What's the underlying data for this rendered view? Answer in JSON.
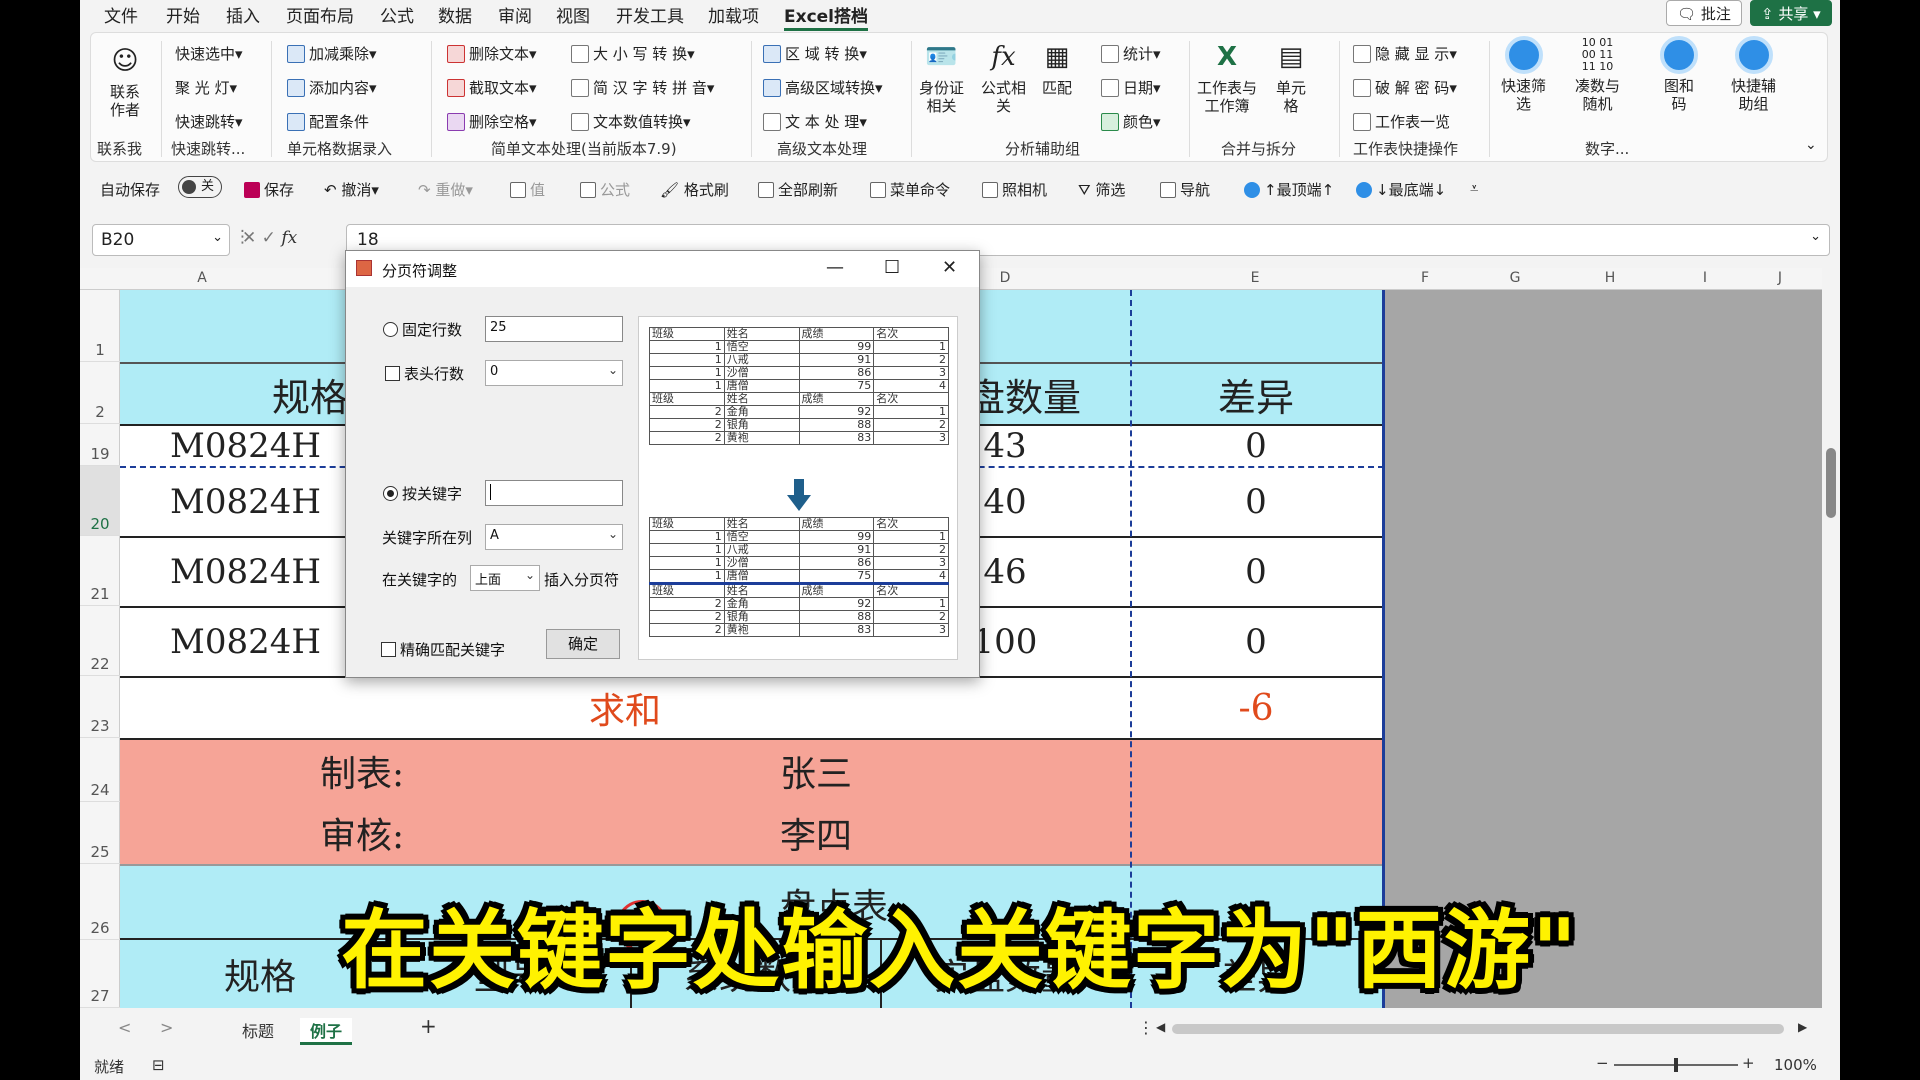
{
  "menu": {
    "items": [
      "文件",
      "开始",
      "插入",
      "页面布局",
      "公式",
      "数据",
      "审阅",
      "视图",
      "开发工具",
      "加载项",
      "Excel搭档"
    ],
    "comment_btn": "批注",
    "share_btn": "共享"
  },
  "ribbon": {
    "contact": {
      "label": "联系\n作者",
      "group": "联系我"
    },
    "g1": {
      "items": [
        "快速选中",
        "聚 光 灯",
        "快速跳转"
      ],
      "group": "快速跳转..."
    },
    "g2": {
      "items": [
        "加减乘除",
        "添加内容",
        "配置条件"
      ],
      "group": "单元格数据录入"
    },
    "g3": {
      "items": [
        "删除文本",
        "截取文本",
        "删除空格",
        "大 小 写 转 换",
        "简 汉 字 转 拼 音",
        "文本数值转换"
      ],
      "group": "简单文本处理(当前版本7.9)"
    },
    "g4": {
      "items": [
        "区 域 转 换",
        "高级区域转换",
        "文 本 处 理"
      ],
      "group": "高级文本处理"
    },
    "g5": {
      "items": [
        "身份证\n相关",
        "公式相\n关",
        "匹配",
        "统计",
        "日期",
        "颜色"
      ],
      "group": "分析辅助组"
    },
    "g6": {
      "items": [
        "工作表与\n工作簿",
        "单元\n格"
      ],
      "group": "合并与拆分"
    },
    "g7": {
      "items": [
        "隐 藏 显 示",
        "破 解 密 码",
        "工作表一览"
      ],
      "group": "工作表快捷操作"
    },
    "g8": {
      "items": [
        "快速筛\n选",
        "凑数与\n随机",
        "图和\n码",
        "快捷辅\n助组"
      ],
      "group": "数字...",
      "binary": "10 01\n00 11\n11 10"
    }
  },
  "qat": {
    "autosave": "自动保存",
    "toggle": "关",
    "items": [
      "保存",
      "撤消",
      "重做",
      "值",
      "公式",
      "格式刷",
      "全部刷新",
      "菜单命令",
      "照相机",
      "筛选",
      "导航",
      "↑最顶端↑",
      "↓最底端↓"
    ]
  },
  "formula_bar": {
    "name_box": "B20",
    "fx": "fx",
    "value": "18"
  },
  "columns": [
    "A",
    "D",
    "E",
    "F",
    "G",
    "H",
    "I",
    "J"
  ],
  "rows": [
    "1",
    "2",
    "19",
    "20",
    "21",
    "22",
    "23",
    "24",
    "25",
    "26",
    "27"
  ],
  "sheet": {
    "title_partial": "表",
    "header_spec_partial": "规格",
    "header_actual": "实盘数量",
    "header_diff": "差异",
    "data_rows": [
      {
        "spec": "M0824H",
        "actual": "43",
        "diff": "0"
      },
      {
        "spec": "M0824H",
        "actual": "40",
        "diff": "0"
      },
      {
        "spec": "M0824H",
        "actual": "46",
        "diff": "0"
      },
      {
        "spec": "M0824H",
        "actual": "100",
        "diff": "0"
      }
    ],
    "sum_label": "求和",
    "sum_value": "-6",
    "maker_label": "制表:",
    "maker_name": "张三",
    "reviewer_label": "审核:",
    "reviewer_name": "李四",
    "row26_partial": "盘点表",
    "row27_a": "规格",
    "row27_b": "型号",
    "row27_c": "系统数量",
    "row27_d": "实盘数量",
    "row27_e": "差异"
  },
  "dialog": {
    "title": "分页符调整",
    "fixed_rows_label": "固定行数",
    "fixed_rows_value": "25",
    "header_rows_label": "表头行数",
    "header_rows_value": "0",
    "by_keyword_label": "按关键字",
    "keyword_value": "",
    "keyword_col_label": "关键字所在列",
    "keyword_col_value": "A",
    "position_prefix": "在关键字的",
    "position_value": "上面",
    "position_suffix": "插入分页符",
    "exact_match_label": "精确匹配关键字",
    "ok_label": "确定"
  },
  "preview": {
    "headers": [
      "班级",
      "姓名",
      "成绩",
      "名次"
    ],
    "group1": [
      [
        "1",
        "悟空",
        "99",
        "1"
      ],
      [
        "1",
        "八戒",
        "91",
        "2"
      ],
      [
        "1",
        "沙僧",
        "86",
        "3"
      ],
      [
        "1",
        "唐僧",
        "75",
        "4"
      ]
    ],
    "group2": [
      [
        "2",
        "金角",
        "92",
        "1"
      ],
      [
        "2",
        "银角",
        "88",
        "2"
      ],
      [
        "2",
        "黄袍",
        "83",
        "3"
      ]
    ]
  },
  "tabs": {
    "items": [
      "标题",
      "例子"
    ],
    "active": "例子",
    "add": "+"
  },
  "status": {
    "ready": "就绪",
    "zoom": "100%"
  },
  "subtitle": "在关键字处输入关键字为\"西游\""
}
